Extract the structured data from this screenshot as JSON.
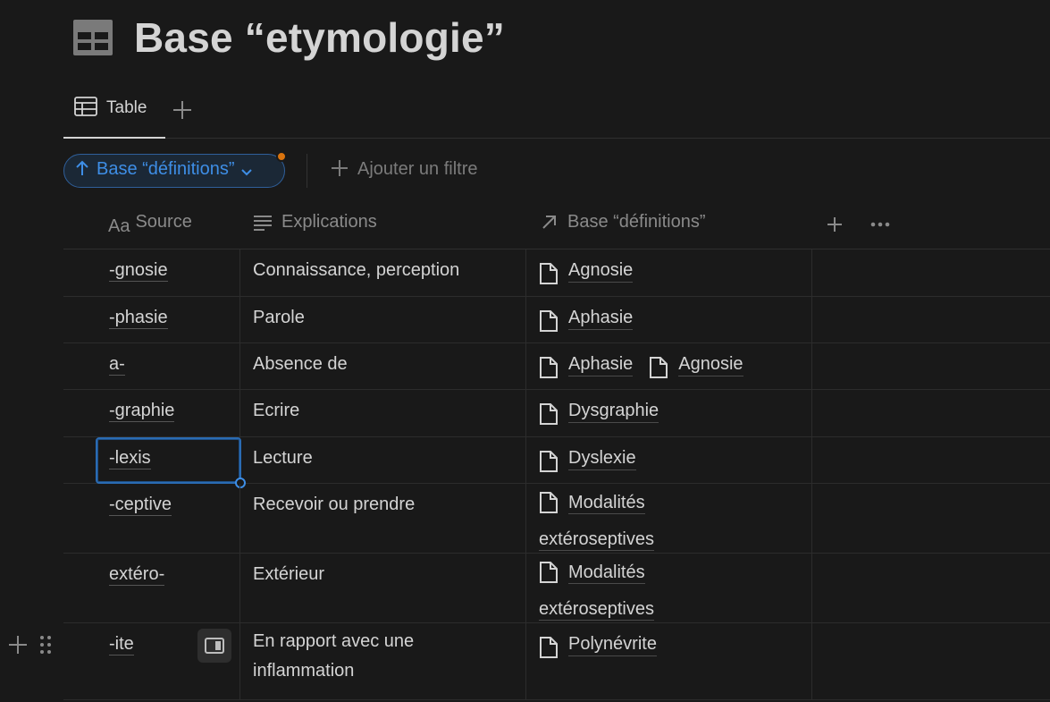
{
  "page": {
    "title": "Base “etymologie”",
    "icon": "table-database-icon"
  },
  "tabs": {
    "active_label": "Table",
    "add_icon": "plus-icon"
  },
  "filters": {
    "sort_label": "Base “définitions”",
    "sort_icon": "arrow-up-icon",
    "indicator_color": "#d9730d",
    "accent_color": "#3e8ee6",
    "add_filter_label": "Ajouter un filtre"
  },
  "table": {
    "columns": [
      {
        "label": "Source",
        "icon": "text-aa-icon"
      },
      {
        "label": "Explications",
        "icon": "lines-icon"
      },
      {
        "label": "Base “définitions”",
        "icon": "relation-arrow-icon"
      }
    ],
    "rows": [
      {
        "source": "-gnosie",
        "explication": "Connaissance, perception",
        "relations": [
          "Agnosie"
        ]
      },
      {
        "source": "-phasie",
        "explication": "Parole",
        "relations": [
          "Aphasie"
        ]
      },
      {
        "source": "a-",
        "explication": "Absence de",
        "relations": [
          "Aphasie",
          "Agnosie"
        ]
      },
      {
        "source": "-graphie",
        "explication": "Ecrire",
        "relations": [
          "Dysgraphie"
        ]
      },
      {
        "source": "-lexis",
        "explication": "Lecture",
        "relations": [
          "Dyslexie"
        ]
      },
      {
        "source": "-ceptive",
        "explication": "Recevoir ou prendre",
        "relations": [
          "Modalités extéroseptives"
        ]
      },
      {
        "source": "extéro-",
        "explication": "Extérieur",
        "relations": [
          "Modalités extéroseptives"
        ]
      },
      {
        "source": "-ite",
        "explication": "En rapport avec une inflammation",
        "relations": [
          "Polynévrite"
        ]
      }
    ]
  }
}
